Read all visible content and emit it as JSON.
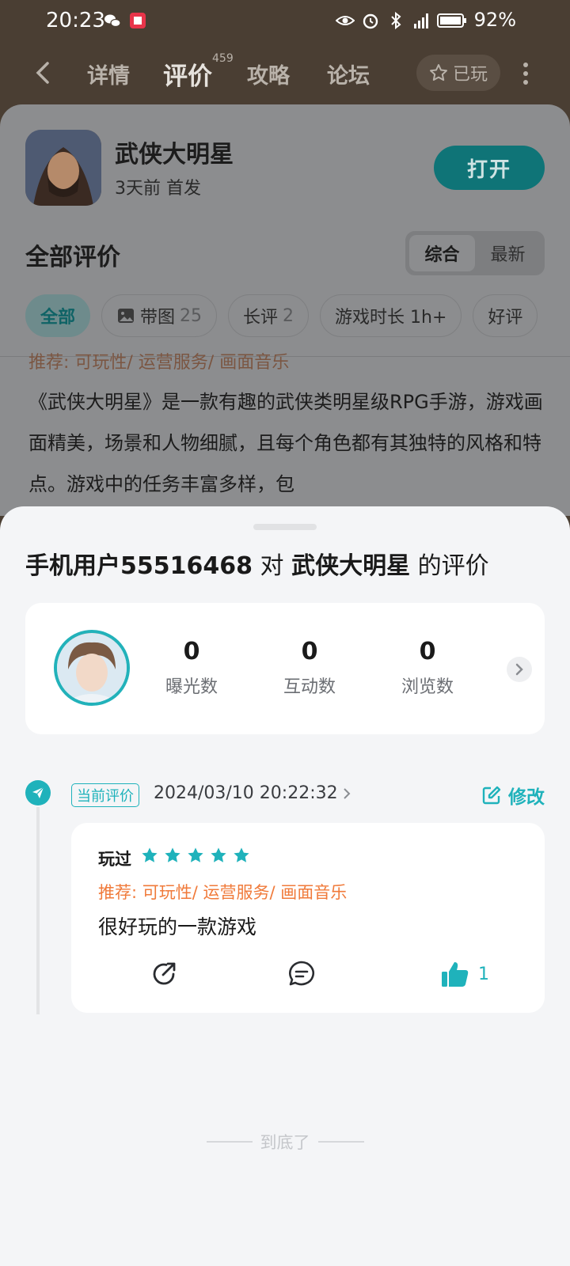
{
  "status_bar": {
    "time": "20:23",
    "battery": "92%"
  },
  "nav": {
    "tabs": [
      "详情",
      "评价",
      "攻略",
      "论坛"
    ],
    "active_tab": "评价",
    "review_count": "459",
    "played_label": "已玩"
  },
  "game": {
    "title": "武侠大明星",
    "subtitle": "3天前 首发",
    "open_label": "打开"
  },
  "reviews_section": {
    "title": "全部评价",
    "sort": [
      "综合",
      "最新"
    ],
    "active_sort": "综合",
    "filters": [
      {
        "label": "全部",
        "count": ""
      },
      {
        "label": "带图",
        "count": "25"
      },
      {
        "label": "长评",
        "count": "2"
      },
      {
        "label": "游戏时长 1h+",
        "count": ""
      },
      {
        "label": "好评",
        "count": ""
      }
    ],
    "preview_recommend": "推荐: 可玩性/ 运营服务/ 画面音乐",
    "preview_text": "《武侠大明星》是一款有趣的武侠类明星级RPG手游，游戏画面精美，场景和人物细腻，且每个角色都有其独特的风格和特点。游戏中的任务丰富多样，包"
  },
  "sheet": {
    "user": "手机用户55516468",
    "connector": "对",
    "game": "武侠大明星",
    "suffix": "的评价",
    "stats": [
      {
        "value": "0",
        "label": "曝光数"
      },
      {
        "value": "0",
        "label": "互动数"
      },
      {
        "value": "0",
        "label": "浏览数"
      }
    ],
    "current_tag": "当前评价",
    "review_time": "2024/03/10 20:22:32",
    "edit_label": "修改",
    "review": {
      "played": "玩过",
      "stars": 5,
      "recommend": "推荐: 可玩性/ 运营服务/ 画面音乐",
      "text": "很好玩的一款游戏",
      "likes": "1"
    },
    "end_text": "到底了"
  },
  "colors": {
    "accent": "#1fb2bb",
    "orange": "#f07a3a",
    "nav_bg": "#4a3e33"
  }
}
